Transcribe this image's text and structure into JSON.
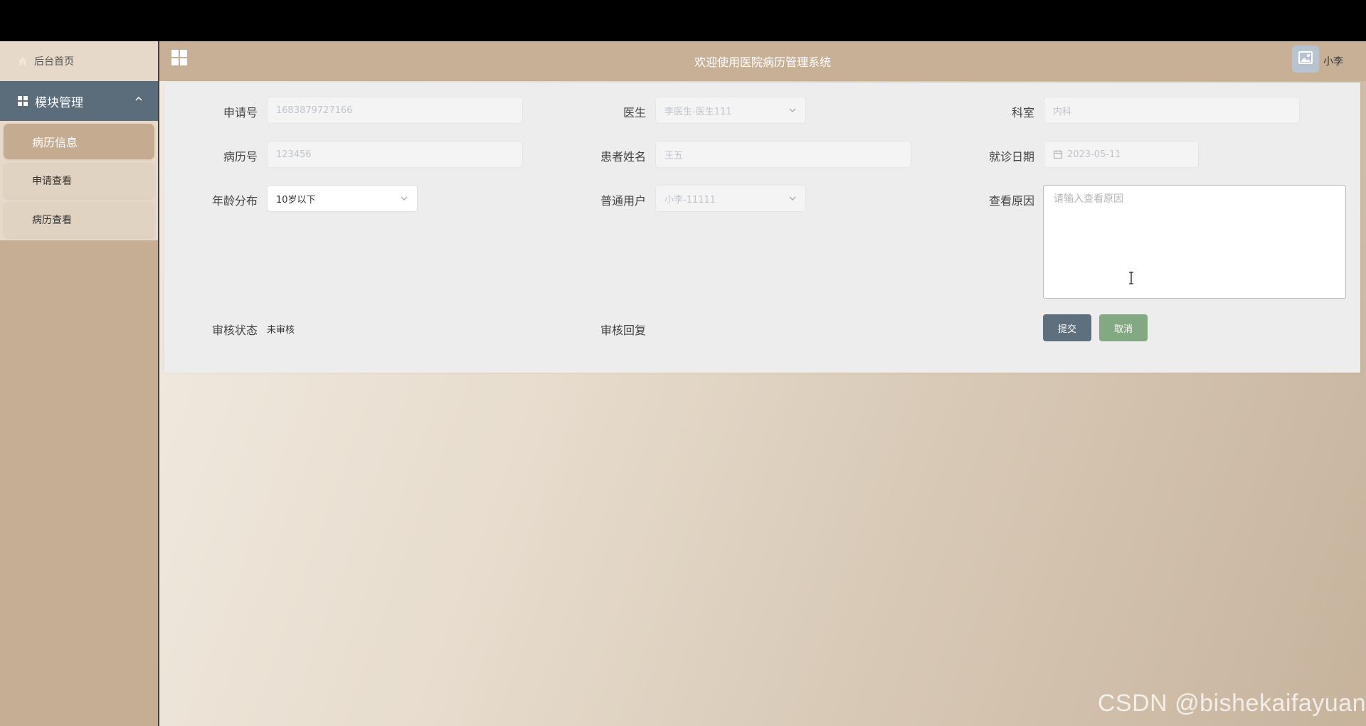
{
  "sidebar": {
    "home_label": "后台首页",
    "module_label": "模块管理",
    "items": [
      {
        "label": "病历信息",
        "active": true
      },
      {
        "label": "申请查看",
        "active": false
      },
      {
        "label": "病历查看",
        "active": false
      }
    ]
  },
  "header": {
    "title": "欢迎使用医院病历管理系统",
    "username": "小李"
  },
  "form": {
    "application_no": {
      "label": "申请号",
      "value": "1683879727166"
    },
    "doctor": {
      "label": "医生",
      "value": "李医生-医生111"
    },
    "department": {
      "label": "科室",
      "value": "内科"
    },
    "record_no": {
      "label": "病历号",
      "value": "123456"
    },
    "patient_name": {
      "label": "患者姓名",
      "value": "王五"
    },
    "visit_date": {
      "label": "就诊日期",
      "value": "2023-05-11"
    },
    "age_group": {
      "label": "年龄分布",
      "value": "10岁以下"
    },
    "user": {
      "label": "普通用户",
      "value": "小李-11111"
    },
    "view_reason": {
      "label": "查看原因",
      "placeholder": "请输入查看原因"
    },
    "review_status": {
      "label": "审核状态",
      "value": "未审核"
    },
    "review_reply": {
      "label": "审核回复"
    },
    "submit_label": "提交",
    "cancel_label": "取消"
  },
  "watermark": "CSDN @bishekaifayuan",
  "colors": {
    "sidebar_bg": "#c5ae94",
    "module_bar": "#5b6c7b",
    "header_bg": "#c8b096",
    "submit": "#5e6f7e",
    "cancel": "#82a981"
  }
}
